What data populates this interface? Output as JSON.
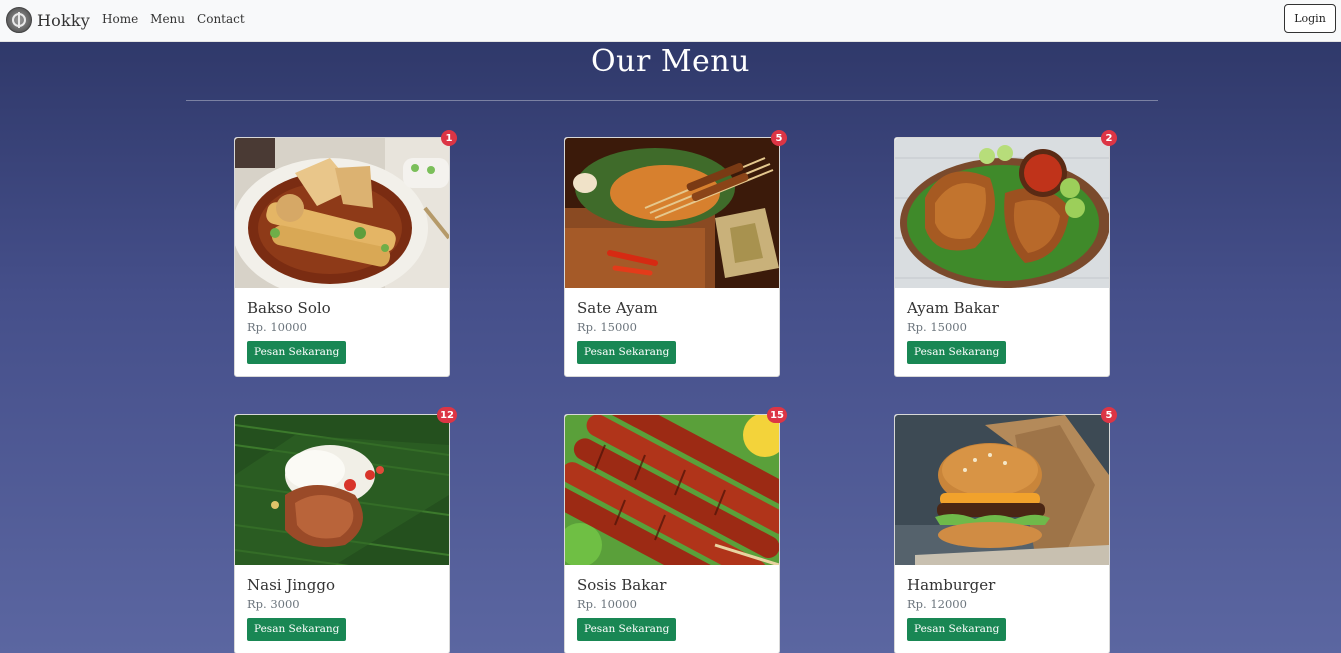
{
  "navbar": {
    "brand": "Hokky",
    "links": [
      "Home",
      "Menu",
      "Contact"
    ],
    "login_label": "Login"
  },
  "page_title": "Our Menu",
  "order_label": "Pesan Sekarang",
  "menu": [
    {
      "name": "Bakso Solo",
      "price": "Rp. 10000",
      "badge": "1",
      "image": "bakso-image"
    },
    {
      "name": "Sate Ayam",
      "price": "Rp. 15000",
      "badge": "5",
      "image": "sate-image"
    },
    {
      "name": "Ayam Bakar",
      "price": "Rp. 15000",
      "badge": "2",
      "image": "ayam-bakar-image"
    },
    {
      "name": "Nasi Jinggo",
      "price": "Rp. 3000",
      "badge": "12",
      "image": "nasi-jinggo-image"
    },
    {
      "name": "Sosis Bakar",
      "price": "Rp. 10000",
      "badge": "15",
      "image": "sosis-bakar-image"
    },
    {
      "name": "Hamburger",
      "price": "Rp. 12000",
      "badge": "5",
      "image": "hamburger-image"
    }
  ],
  "colors": {
    "order_button": "#198754",
    "badge": "#dc3545",
    "background_top": "#2c3565",
    "background_bottom": "#5b66a1"
  }
}
